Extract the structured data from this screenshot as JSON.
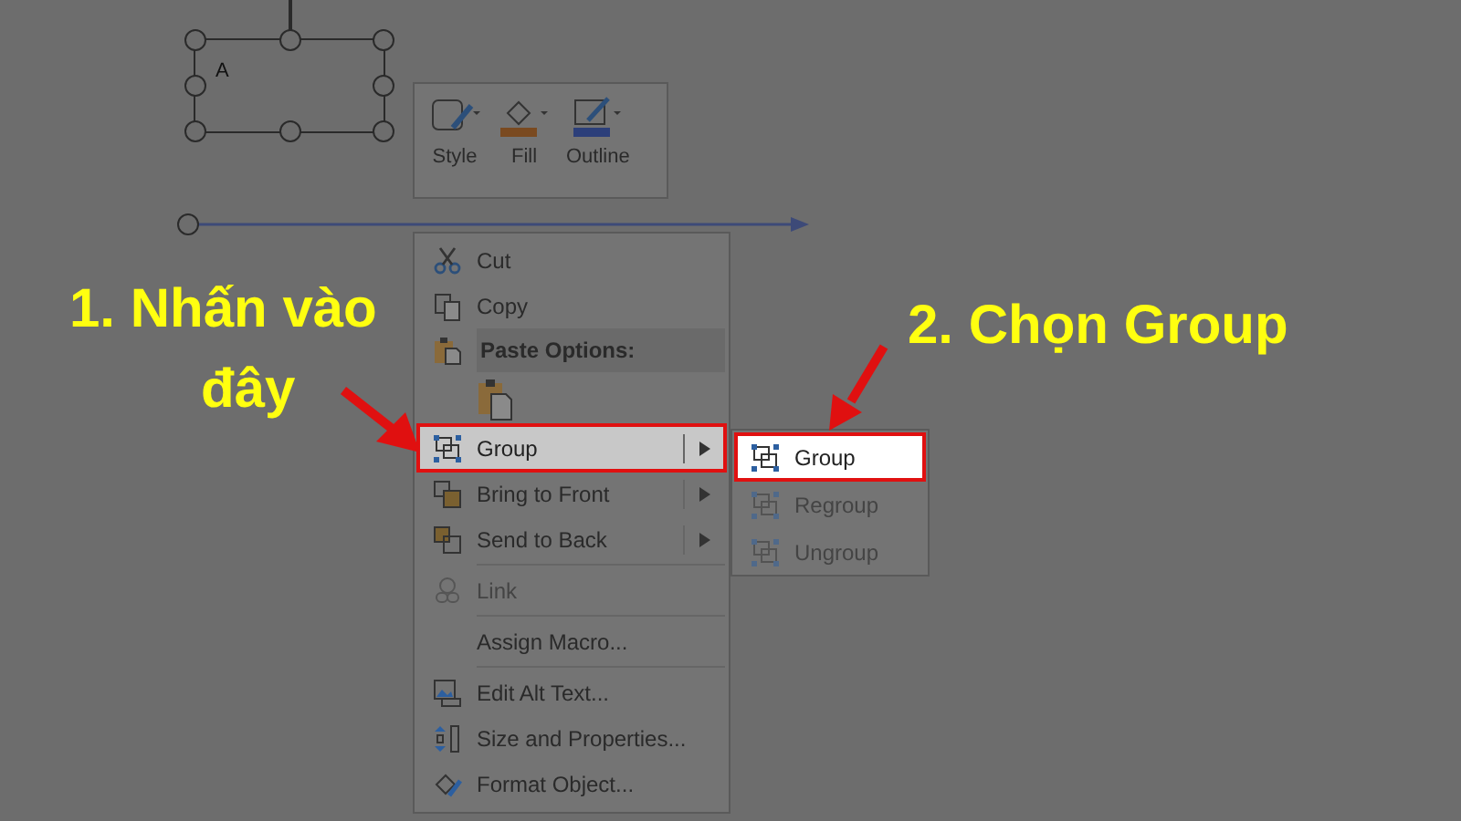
{
  "shape": {
    "label": "A"
  },
  "mini_toolbar": {
    "buttons": [
      {
        "label": "Style"
      },
      {
        "label": "Fill"
      },
      {
        "label": "Outline"
      }
    ]
  },
  "context_menu": {
    "sections": [
      [
        {
          "kind": "item",
          "label": "Cut",
          "disabled": false,
          "submenu": false,
          "highlighted": false
        },
        {
          "kind": "item",
          "label": "Copy",
          "disabled": false,
          "submenu": false,
          "highlighted": false
        },
        {
          "kind": "header",
          "label": "Paste Options:"
        },
        {
          "kind": "paste"
        },
        {
          "kind": "item",
          "label": "Group",
          "disabled": false,
          "submenu": true,
          "highlighted": true
        },
        {
          "kind": "item",
          "label": "Bring to Front",
          "disabled": false,
          "submenu": true,
          "highlighted": false
        },
        {
          "kind": "item",
          "label": "Send to Back",
          "disabled": false,
          "submenu": true,
          "highlighted": false
        }
      ],
      [
        {
          "kind": "item",
          "label": "Link",
          "disabled": true,
          "submenu": false,
          "highlighted": false
        }
      ],
      [
        {
          "kind": "item",
          "label": "Assign Macro...",
          "disabled": false,
          "submenu": false,
          "highlighted": false
        }
      ],
      [
        {
          "kind": "item",
          "label": "Edit Alt Text...",
          "disabled": false,
          "submenu": false,
          "highlighted": false
        },
        {
          "kind": "item",
          "label": "Size and Properties...",
          "disabled": false,
          "submenu": false,
          "highlighted": false
        },
        {
          "kind": "item",
          "label": "Format Object...",
          "disabled": false,
          "submenu": false,
          "highlighted": false
        }
      ]
    ]
  },
  "submenu": {
    "items": [
      {
        "label": "Group",
        "disabled": false,
        "highlighted": true
      },
      {
        "label": "Regroup",
        "disabled": true,
        "highlighted": false
      },
      {
        "label": "Ungroup",
        "disabled": true,
        "highlighted": false
      }
    ]
  },
  "annotations": [
    {
      "lines": [
        "1. Nhấn vào",
        "đây"
      ]
    },
    {
      "lines": [
        "2. Chọn Group"
      ]
    }
  ]
}
